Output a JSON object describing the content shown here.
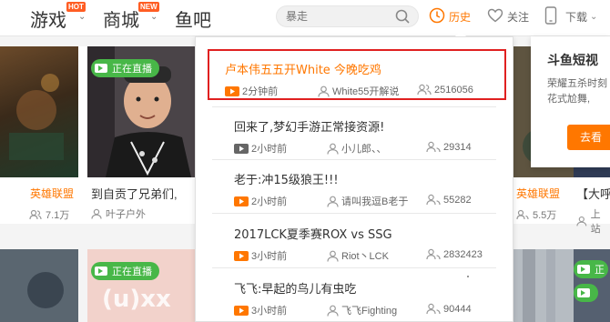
{
  "header": {
    "nav": [
      {
        "label": "游戏",
        "badge": "HOT"
      },
      {
        "label": "商城",
        "badge": "NEW"
      },
      {
        "label": "鱼吧"
      }
    ],
    "search": {
      "placeholder": "暴走"
    },
    "history_label": "历史",
    "follow_label": "关注",
    "download_label": "下载",
    "accent_color": "#ff7700"
  },
  "cards_left": [
    {
      "live": "正在直播",
      "game": "英雄联盟",
      "title": "到自贡了兄弟们,",
      "views": "7.1万",
      "anchor": "叶子户外"
    },
    {
      "live": "正在直播"
    }
  ],
  "cards_right": [
    {
      "game": "英雄联盟",
      "views": "5.5万"
    },
    {
      "title": "【大呼",
      "anchor": "上站"
    },
    {
      "live": "正"
    }
  ],
  "history": {
    "items": [
      {
        "title": "卢本伟五五开White 今晚吃鸡",
        "time": "2分钟前",
        "anchor": "White55开解说",
        "views": "2516056",
        "live_icon": true,
        "highlighted": true
      },
      {
        "title": "回来了,梦幻手游正常接资源!",
        "time": "2小时前",
        "anchor": "小儿郎、、",
        "views": "29314",
        "live_icon": false
      },
      {
        "title": "老于:冲15级狼王!!!",
        "time": "2小时前",
        "anchor": "请叫我逗B老于",
        "views": "55282",
        "live_icon": true
      },
      {
        "title": "2017LCK夏季赛ROX vs SSG",
        "time": "3小时前",
        "anchor": "Riot丶LCK",
        "views": "2832423",
        "live_icon": true
      },
      {
        "title": "飞飞:早起的鸟儿有虫吃",
        "time": "3小时前",
        "anchor": "飞飞Fighting",
        "views": "90444",
        "live_icon": true
      }
    ]
  },
  "promo": {
    "title": "斗鱼短视",
    "description": "荣耀五杀时刻花式尬舞,",
    "button": "去看"
  }
}
